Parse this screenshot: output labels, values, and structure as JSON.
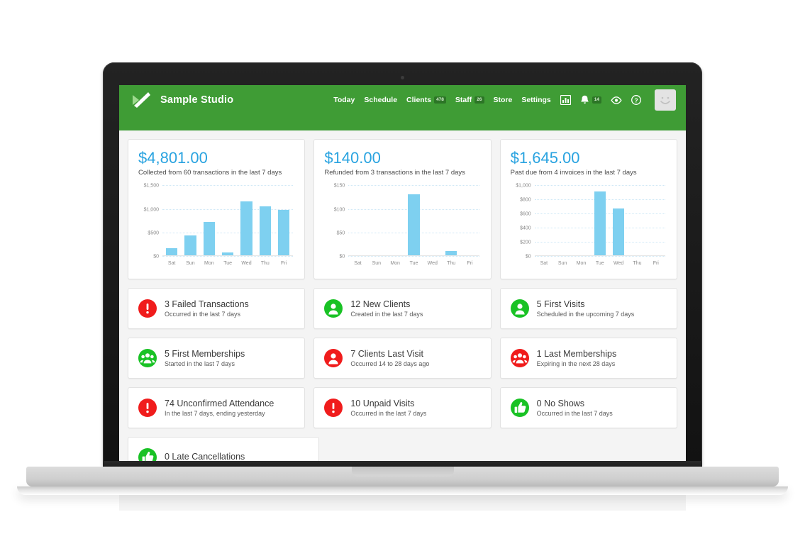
{
  "app": {
    "brand_name": "Sample Studio",
    "logo_icon": "checkmark-slash-logo",
    "accent_green": "#3f9c35",
    "accent_blue": "#29a3e0",
    "bar_color": "#7ed0f0",
    "danger_color": "#f01c1c",
    "success_color": "#19c225"
  },
  "nav": {
    "items": [
      {
        "label": "Today",
        "badge": null
      },
      {
        "label": "Schedule",
        "badge": null
      },
      {
        "label": "Clients",
        "badge": "478"
      },
      {
        "label": "Staff",
        "badge": "26"
      },
      {
        "label": "Store",
        "badge": null
      },
      {
        "label": "Settings",
        "badge": null
      }
    ],
    "icons": [
      {
        "name": "reports-icon",
        "glyph": "ὌA"
      },
      {
        "name": "notifications-bell-icon",
        "badge": "14"
      },
      {
        "name": "eye-icon"
      },
      {
        "name": "help-icon",
        "glyph": "?"
      }
    ],
    "avatar_name": "user-avatar"
  },
  "charts": [
    {
      "amount": "$4,801.00",
      "subtitle": "Collected from 60 transactions in the last 7 days"
    },
    {
      "amount": "$140.00",
      "subtitle": "Refunded from 3 transactions in the last 7 days"
    },
    {
      "amount": "$1,645.00",
      "subtitle": "Past due from 4 invoices in the last 7 days"
    }
  ],
  "chart_data": [
    {
      "type": "bar",
      "title": "$4,801.00",
      "subtitle": "Collected from 60 transactions in the last 7 days",
      "categories": [
        "Sat",
        "Sun",
        "Mon",
        "Tue",
        "Wed",
        "Thu",
        "Fri"
      ],
      "values": [
        150,
        420,
        720,
        70,
        1150,
        1050,
        970
      ],
      "ytick_labels": [
        "$0",
        "$500",
        "$1,000",
        "$1,500"
      ],
      "yticks": [
        0,
        500,
        1000,
        1500
      ],
      "ylim": [
        0,
        1500
      ],
      "xlabel": "",
      "ylabel": "",
      "grid": true,
      "legend": "none",
      "color": "#7ed0f0"
    },
    {
      "type": "bar",
      "title": "$140.00",
      "subtitle": "Refunded from 3 transactions in the last 7 days",
      "categories": [
        "Sat",
        "Sun",
        "Mon",
        "Tue",
        "Wed",
        "Thu",
        "Fri"
      ],
      "values": [
        0,
        0,
        0,
        130,
        0,
        10,
        0
      ],
      "ytick_labels": [
        "$0",
        "$50",
        "$100",
        "$150"
      ],
      "yticks": [
        0,
        50,
        100,
        150
      ],
      "ylim": [
        0,
        150
      ],
      "xlabel": "",
      "ylabel": "",
      "grid": true,
      "legend": "none",
      "color": "#7ed0f0"
    },
    {
      "type": "bar",
      "title": "$1,645.00",
      "subtitle": "Past due from 4 invoices in the last 7 days",
      "categories": [
        "Sat",
        "Sun",
        "Mon",
        "Tue",
        "Wed",
        "Thu",
        "Fri"
      ],
      "values": [
        0,
        0,
        0,
        910,
        670,
        0,
        0
      ],
      "ytick_labels": [
        "$0",
        "$200",
        "$400",
        "$600",
        "$800",
        "$1,000"
      ],
      "yticks": [
        0,
        200,
        400,
        600,
        800,
        1000
      ],
      "ylim": [
        0,
        1000
      ],
      "xlabel": "",
      "ylabel": "",
      "grid": true,
      "legend": "none",
      "color": "#7ed0f0"
    }
  ],
  "stats": [
    {
      "title": "3 Failed Transactions",
      "subtitle": "Occurred in the last 7 days",
      "icon": "alert-exclamation-icon",
      "tone": "red"
    },
    {
      "title": "12 New Clients",
      "subtitle": "Created in the last 7 days",
      "icon": "person-icon",
      "tone": "green"
    },
    {
      "title": "5 First Visits",
      "subtitle": "Scheduled in the upcoming 7 days",
      "icon": "person-icon",
      "tone": "green"
    },
    {
      "title": "5 First Memberships",
      "subtitle": "Started in the last 7 days",
      "icon": "people-group-icon",
      "tone": "green"
    },
    {
      "title": "7 Clients Last Visit",
      "subtitle": "Occurred 14 to 28 days ago",
      "icon": "person-icon",
      "tone": "red"
    },
    {
      "title": "1 Last Memberships",
      "subtitle": "Expiring in the next 28 days",
      "icon": "people-group-icon",
      "tone": "red"
    },
    {
      "title": "74 Unconfirmed Attendance",
      "subtitle": "In the last 7 days, ending yesterday",
      "icon": "alert-exclamation-icon",
      "tone": "red"
    },
    {
      "title": "10 Unpaid Visits",
      "subtitle": "Occurred in the last 7 days",
      "icon": "alert-exclamation-icon",
      "tone": "red"
    },
    {
      "title": "0 No Shows",
      "subtitle": "Occurred in the last 7 days",
      "icon": "thumbs-up-icon",
      "tone": "green"
    },
    {
      "title": "0 Late Cancellations",
      "subtitle": "",
      "icon": "thumbs-up-icon",
      "tone": "green"
    }
  ]
}
